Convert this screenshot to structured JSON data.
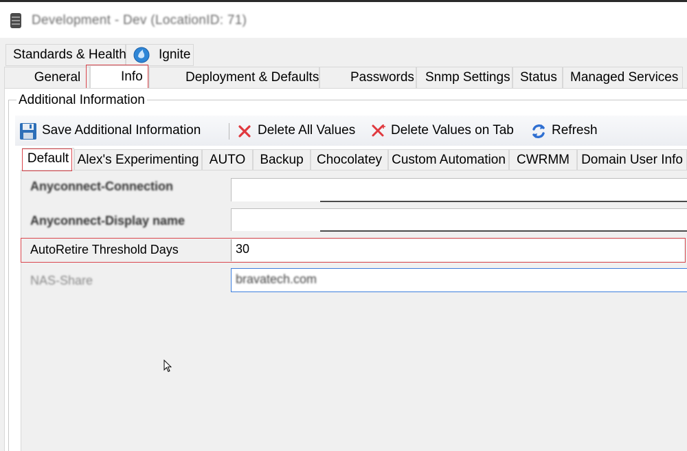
{
  "window": {
    "title": "Development - Dev    (LocationID: 71)",
    "icon": "database-icon"
  },
  "top_tabs_row1": [
    {
      "label": "Standards & Health"
    },
    {
      "label": "Ignite",
      "icon": "ignite-globe-icon"
    }
  ],
  "top_tabs_row2": [
    {
      "label": "General"
    },
    {
      "label": "Info",
      "selected": true
    },
    {
      "label": "Deployment & Defaults"
    },
    {
      "label": "Passwords"
    },
    {
      "label": "Snmp Settings"
    },
    {
      "label": "Status"
    },
    {
      "label": "Managed Services"
    }
  ],
  "group": {
    "label": "Additional Information"
  },
  "toolbar": {
    "save_label": "Save Additional Information",
    "delete_all_label": "Delete All Values",
    "delete_tab_label": "Delete Values on Tab",
    "refresh_label": "Refresh",
    "icons": [
      "save-disk-icon",
      "red-x-icon",
      "red-x-multi-icon",
      "refresh-arrows-icon"
    ]
  },
  "sub_tabs": [
    {
      "label": "Default",
      "selected": true
    },
    {
      "label": "Alex's Experimenting"
    },
    {
      "label": "AUTO"
    },
    {
      "label": "Backup"
    },
    {
      "label": "Chocolatey"
    },
    {
      "label": "Custom Automation"
    },
    {
      "label": "CWRMM"
    },
    {
      "label": "Domain User Info"
    }
  ],
  "fields": [
    {
      "label": "Anyconnect-Connection",
      "value": ""
    },
    {
      "label": "Anyconnect-Display name",
      "value": ""
    },
    {
      "label": "AutoRetire Threshold Days",
      "value": "30"
    },
    {
      "label": "NAS-Share",
      "value": "bravatech.com"
    }
  ],
  "colors": {
    "highlight_red": "#d9454c",
    "focus_blue": "#3b7ddd",
    "delete_red": "#e0383e",
    "refresh_blue": "#2f6fd1"
  }
}
